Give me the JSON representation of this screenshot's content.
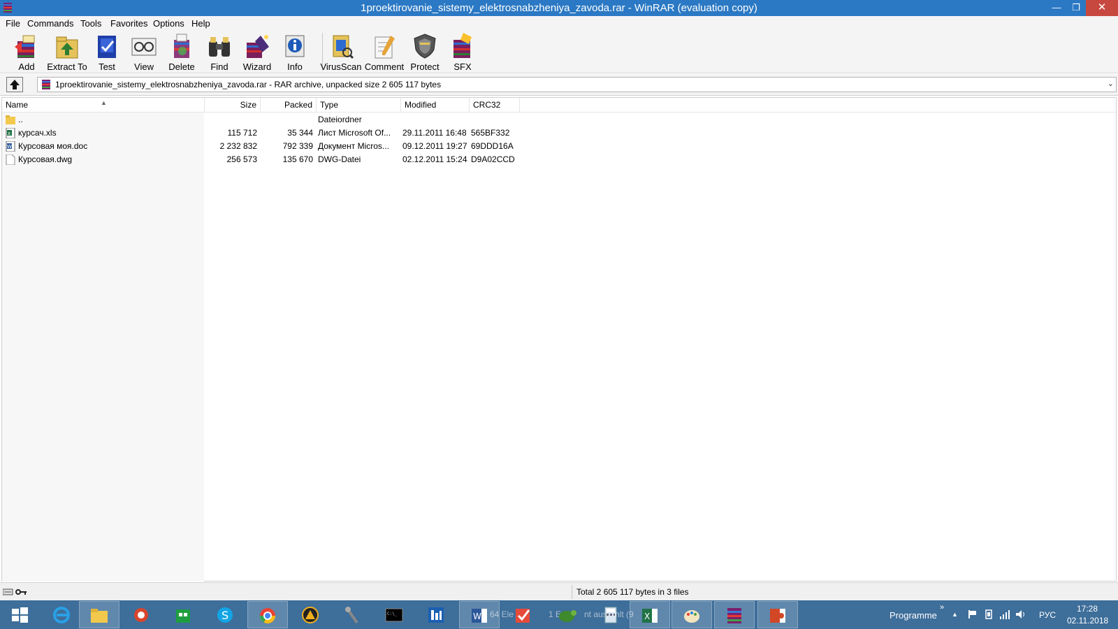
{
  "window": {
    "title": "1proektirovanie_sistemy_elektrosnabzheniya_zavoda.rar - WinRAR (evaluation copy)",
    "minimize_glyph": "—",
    "maximize_glyph": "❐",
    "close_glyph": "✕"
  },
  "menu": [
    "File",
    "Commands",
    "Tools",
    "Favorites",
    "Options",
    "Help"
  ],
  "toolbar": [
    {
      "label": "Add",
      "icon": "add-archive-icon"
    },
    {
      "label": "Extract To",
      "icon": "extract-to-icon"
    },
    {
      "label": "Test",
      "icon": "test-icon"
    },
    {
      "label": "View",
      "icon": "view-icon"
    },
    {
      "label": "Delete",
      "icon": "delete-icon"
    },
    {
      "label": "Find",
      "icon": "find-binoculars-icon"
    },
    {
      "label": "Wizard",
      "icon": "wizard-icon"
    },
    {
      "label": "Info",
      "icon": "info-icon"
    },
    {
      "label": "VirusScan",
      "icon": "virusscan-icon"
    },
    {
      "label": "Comment",
      "icon": "comment-icon"
    },
    {
      "label": "Protect",
      "icon": "protect-shield-icon"
    },
    {
      "label": "SFX",
      "icon": "sfx-icon"
    }
  ],
  "address": {
    "text": "1proektirovanie_sistemy_elektrosnabzheniya_zavoda.rar - RAR archive, unpacked size 2 605 117 bytes"
  },
  "columns": {
    "name": "Name",
    "size": "Size",
    "packed": "Packed",
    "type": "Type",
    "modified": "Modified",
    "crc": "CRC32"
  },
  "rows": [
    {
      "name": "..",
      "size": "",
      "packed": "",
      "type": "Dateiordner",
      "modified": "",
      "crc": "",
      "icon": "folder-icon"
    },
    {
      "name": "курсач.xls",
      "size": "115 712",
      "packed": "35 344",
      "type": "Лист Microsoft Of...",
      "modified": "29.11.2011 16:48",
      "crc": "565BF332",
      "icon": "excel-file-icon"
    },
    {
      "name": "Курсовая моя.doc",
      "size": "2 232 832",
      "packed": "792 339",
      "type": "Документ Micros...",
      "modified": "09.12.2011 19:27",
      "crc": "69DDD16A",
      "icon": "word-file-icon"
    },
    {
      "name": "Курсовая.dwg",
      "size": "256 573",
      "packed": "135 670",
      "type": "DWG-Datei",
      "modified": "02.12.2011 15:24",
      "crc": "D9A02CCD",
      "icon": "blank-file-icon"
    }
  ],
  "status": {
    "text": "Total 2 605 117 bytes in 3 files"
  },
  "taskbar": {
    "faint_item_1": "64 Ele",
    "faint_item_2": "1 E",
    "faint_item_3": "nt aus",
    "faint_item_4": "hlt (9",
    "programs_label": "Programme",
    "programs_chevron": "»",
    "tray_up": "▲",
    "language": "РУС",
    "time": "17:28",
    "date": "02.11.2018"
  }
}
